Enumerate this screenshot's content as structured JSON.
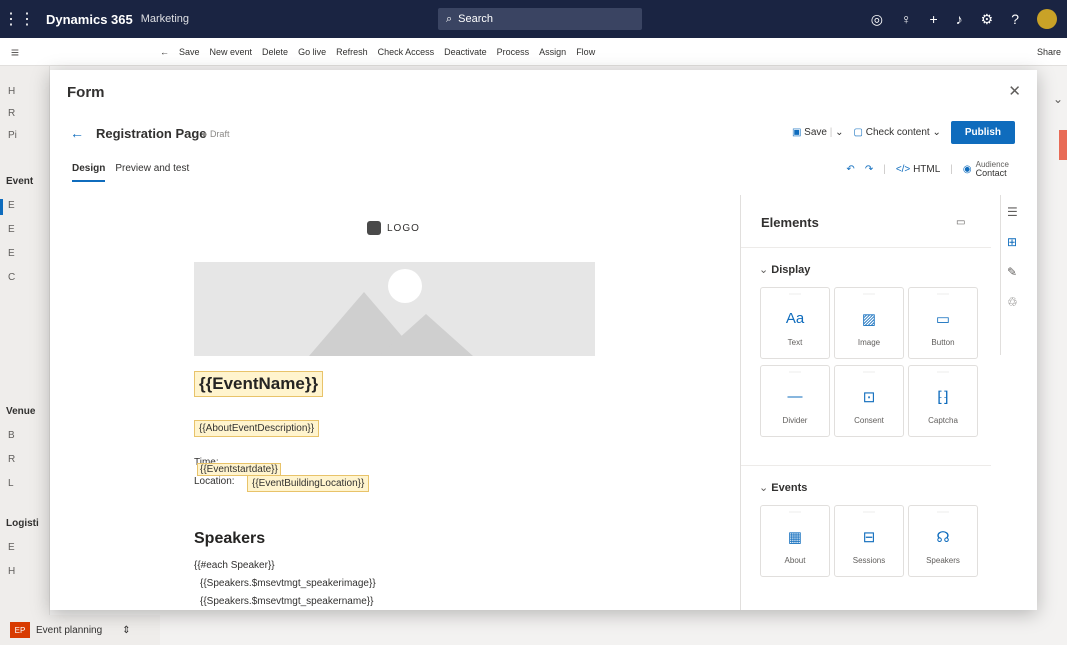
{
  "topbar": {
    "app_name": "Dynamics 365",
    "area_name": "Marketing",
    "search_placeholder": "Search",
    "icons": [
      "target-icon",
      "lightbulb-icon",
      "plus-icon",
      "assistant-icon",
      "gear-icon",
      "help-icon",
      "avatar"
    ]
  },
  "command_bar": {
    "items": [
      "Save",
      "New event",
      "Delete",
      "Go live",
      "Refresh",
      "Check Access",
      "Deactivate",
      "Process",
      "Assign",
      "Flow"
    ],
    "share": "Share"
  },
  "leftnav": {
    "rows_top": [
      "H",
      "R",
      "Pi"
    ],
    "section_event": "Event",
    "rows_event": [
      "E",
      "E",
      "E",
      "C"
    ],
    "section_venue": "Venue",
    "rows_venue": [
      "B",
      "R",
      "L"
    ],
    "section_logistics": "Logisti",
    "rows_logistics": [
      "E",
      "H"
    ],
    "area_switcher": {
      "badge": "EP",
      "label": "Event planning"
    }
  },
  "modal": {
    "title": "Form",
    "page_title": "Registration Page",
    "status": "Draft",
    "save_label": "Save",
    "check_content_label": "Check content",
    "publish_label": "Publish",
    "tabs": [
      "Design",
      "Preview and test"
    ],
    "html_label": "HTML",
    "audience_label": "Audience",
    "audience_value": "Contact"
  },
  "canvas": {
    "logo_text": "LOGO",
    "event_name_token": "{{EventName}}",
    "about_token": "{{AboutEventDescription}}",
    "time_label": "Time:",
    "time_token": "{{Eventstartdate}}",
    "location_label": "Location:",
    "location_token": "{{EventBuildingLocation}}",
    "speakers_heading": "Speakers",
    "speaker_lines": [
      "{{#each Speaker}}",
      "{{Speakers.$msevtmgt_speakerimage}}",
      "{{Speakers.$msevtmgt_speakername}}"
    ]
  },
  "elements_panel": {
    "title": "Elements",
    "display_section": "Display",
    "display_tiles": [
      {
        "label": "Text",
        "icon": "text-icon"
      },
      {
        "label": "Image",
        "icon": "image-icon"
      },
      {
        "label": "Button",
        "icon": "button-icon"
      },
      {
        "label": "Divider",
        "icon": "divider-icon"
      },
      {
        "label": "Consent",
        "icon": "consent-icon"
      },
      {
        "label": "Captcha",
        "icon": "captcha-icon"
      }
    ],
    "events_section": "Events",
    "events_tiles": [
      {
        "label": "About",
        "icon": "calendar-icon"
      },
      {
        "label": "Sessions",
        "icon": "sessions-icon"
      },
      {
        "label": "Speakers",
        "icon": "speaker-icon"
      }
    ]
  },
  "colors": {
    "topbar": "#1a2442",
    "accent": "#0f6cbd",
    "token_fill": "#fff4ce",
    "token_border": "#e8c36a"
  }
}
